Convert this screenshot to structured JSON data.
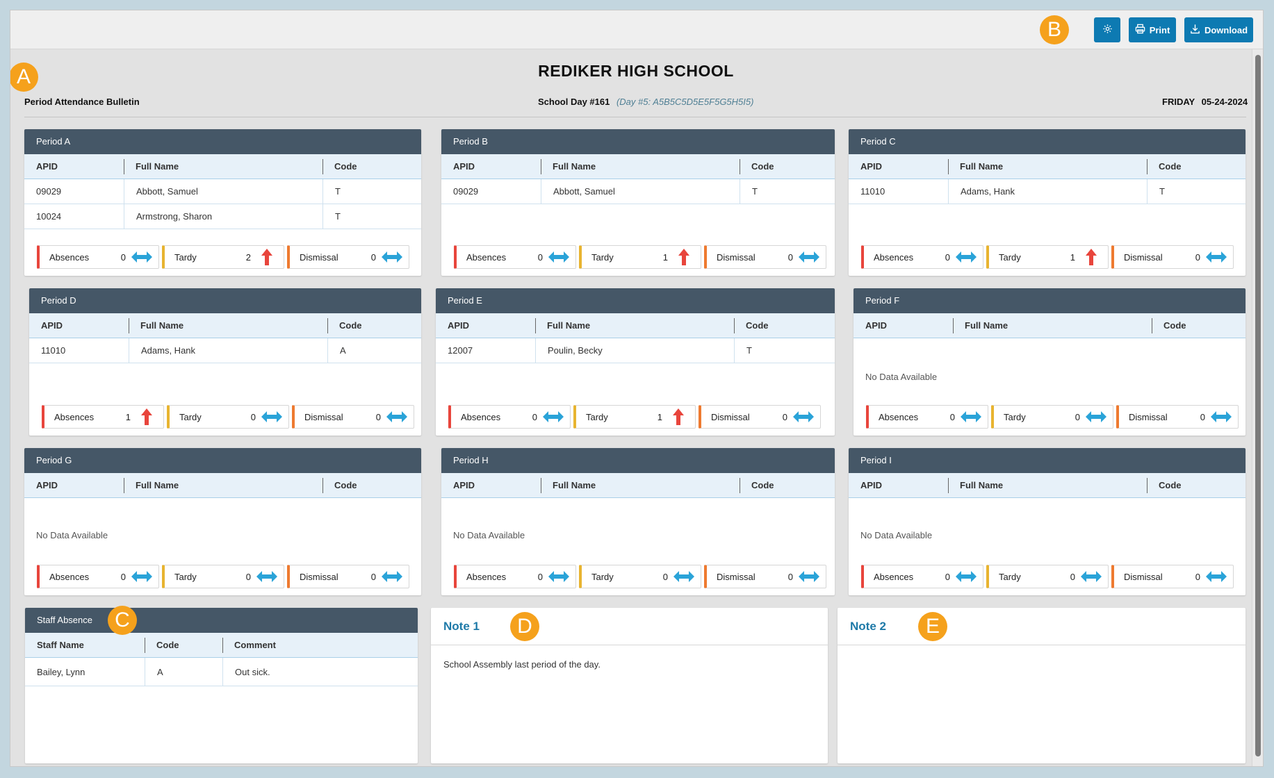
{
  "toolbar": {
    "print_label": "Print",
    "download_label": "Download",
    "settings_icon": "gear-icon",
    "print_icon": "printer-icon",
    "download_icon": "download-icon"
  },
  "markers": {
    "a": "A",
    "b": "B",
    "c": "C",
    "d": "D",
    "e": "E"
  },
  "header": {
    "school_name": "REDIKER HIGH SCHOOL",
    "bulletin_title": "Period Attendance Bulletin",
    "school_day": "School Day #161",
    "day_detail": "(Day #5: A5B5C5D5E5F5G5H5I5)",
    "weekday": "FRIDAY",
    "date": "05-24-2024"
  },
  "columns": {
    "apid": "APID",
    "full_name": "Full Name",
    "code": "Code"
  },
  "stat_labels": {
    "absences": "Absences",
    "tardy": "Tardy",
    "dismissal": "Dismissal"
  },
  "no_data": "No Data Available",
  "colors": {
    "absences": "#e8453c",
    "tardy": "#e8b430",
    "dismissal": "#ee7a30",
    "header_bar": "#455767",
    "accent": "#0d7ab2",
    "trend_up": "#e8453c",
    "trend_flat": "#2aa3d8"
  },
  "periods": {
    "a": {
      "title": "Period A",
      "rows": [
        {
          "apid": "09029",
          "name": "Abbott, Samuel",
          "code": "T"
        },
        {
          "apid": "10024",
          "name": "Armstrong, Sharon",
          "code": "T"
        }
      ],
      "absences": "0",
      "absences_trend": "flat",
      "tardy": "2",
      "tardy_trend": "up",
      "dismissal": "0",
      "dismissal_trend": "flat"
    },
    "b": {
      "title": "Period B",
      "rows": [
        {
          "apid": "09029",
          "name": "Abbott, Samuel",
          "code": "T"
        }
      ],
      "absences": "0",
      "absences_trend": "flat",
      "tardy": "1",
      "tardy_trend": "up",
      "dismissal": "0",
      "dismissal_trend": "flat"
    },
    "c": {
      "title": "Period C",
      "rows": [
        {
          "apid": "11010",
          "name": "Adams, Hank",
          "code": "T"
        }
      ],
      "absences": "0",
      "absences_trend": "flat",
      "tardy": "1",
      "tardy_trend": "up",
      "dismissal": "0",
      "dismissal_trend": "flat"
    },
    "d": {
      "title": "Period D",
      "rows": [
        {
          "apid": "11010",
          "name": "Adams, Hank",
          "code": "A"
        }
      ],
      "absences": "1",
      "absences_trend": "up",
      "tardy": "0",
      "tardy_trend": "flat",
      "dismissal": "0",
      "dismissal_trend": "flat"
    },
    "e": {
      "title": "Period E",
      "rows": [
        {
          "apid": "12007",
          "name": "Poulin, Becky",
          "code": "T"
        }
      ],
      "absences": "0",
      "absences_trend": "flat",
      "tardy": "1",
      "tardy_trend": "up",
      "dismissal": "0",
      "dismissal_trend": "flat"
    },
    "f": {
      "title": "Period F",
      "rows": [],
      "absences": "0",
      "absences_trend": "flat",
      "tardy": "0",
      "tardy_trend": "flat",
      "dismissal": "0",
      "dismissal_trend": "flat"
    },
    "g": {
      "title": "Period G",
      "rows": [],
      "absences": "0",
      "absences_trend": "flat",
      "tardy": "0",
      "tardy_trend": "flat",
      "dismissal": "0",
      "dismissal_trend": "flat"
    },
    "h": {
      "title": "Period H",
      "rows": [],
      "absences": "0",
      "absences_trend": "flat",
      "tardy": "0",
      "tardy_trend": "flat",
      "dismissal": "0",
      "dismissal_trend": "flat"
    },
    "i": {
      "title": "Period I",
      "rows": [],
      "absences": "0",
      "absences_trend": "flat",
      "tardy": "0",
      "tardy_trend": "flat",
      "dismissal": "0",
      "dismissal_trend": "flat"
    }
  },
  "staff": {
    "title": "Staff Absence",
    "columns": {
      "staff_name": "Staff Name",
      "code": "Code",
      "comment": "Comment"
    },
    "rows": [
      {
        "name": "Bailey, Lynn",
        "code": "A",
        "comment": "Out sick."
      }
    ]
  },
  "notes": {
    "note1": {
      "title": "Note 1",
      "body": "School Assembly last period of the day."
    },
    "note2": {
      "title": "Note 2",
      "body": ""
    }
  }
}
